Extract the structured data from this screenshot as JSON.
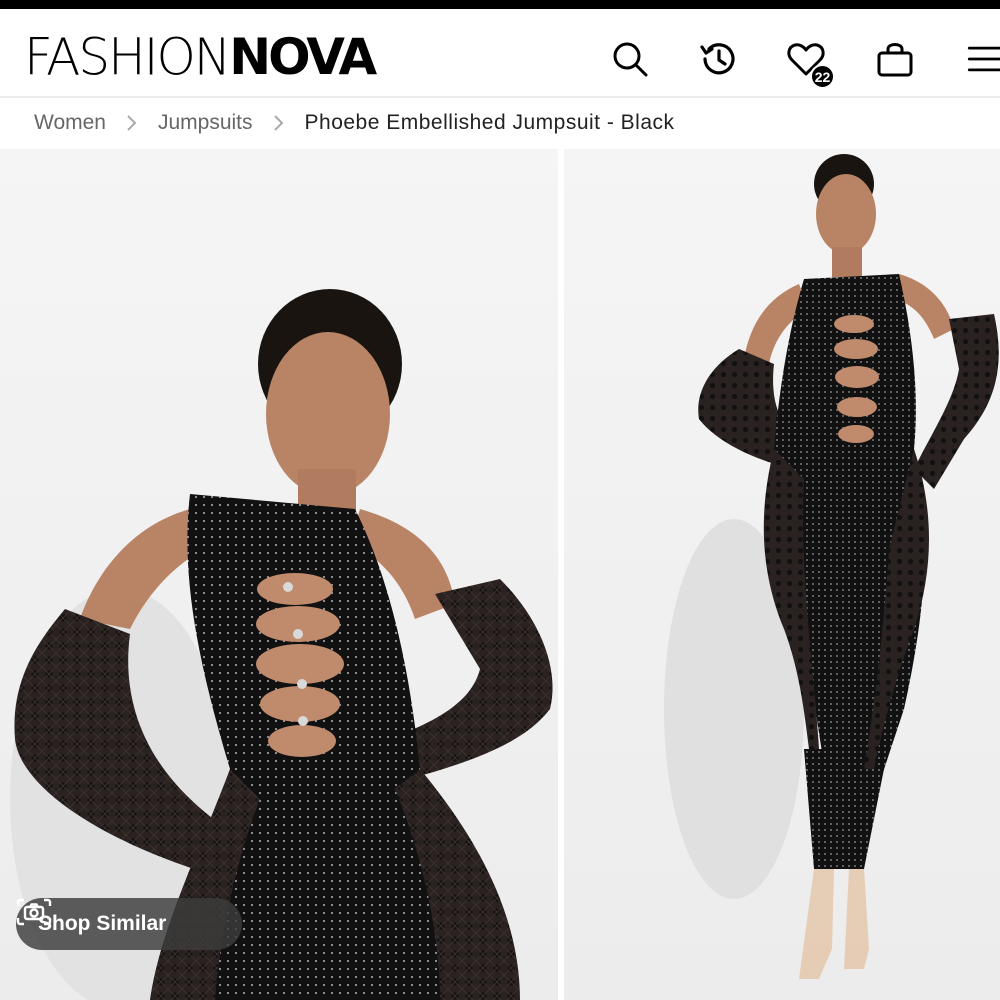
{
  "header": {
    "logo_light": "FASHION",
    "logo_bold": "NOVA",
    "icons": [
      "search-icon",
      "history-icon",
      "heart-icon",
      "bag-icon",
      "menu-icon"
    ],
    "wishlist_count": "22"
  },
  "breadcrumb": {
    "items": [
      "Women",
      "Jumpsuits"
    ],
    "current": "Phoebe Embellished Jumpsuit - Black"
  },
  "gallery": {
    "shop_similar_label": "Shop Similar"
  },
  "colors": {
    "brand": "#000000",
    "pill_bg": "#3c3c3c",
    "photo_bg": "#eeeeee"
  }
}
